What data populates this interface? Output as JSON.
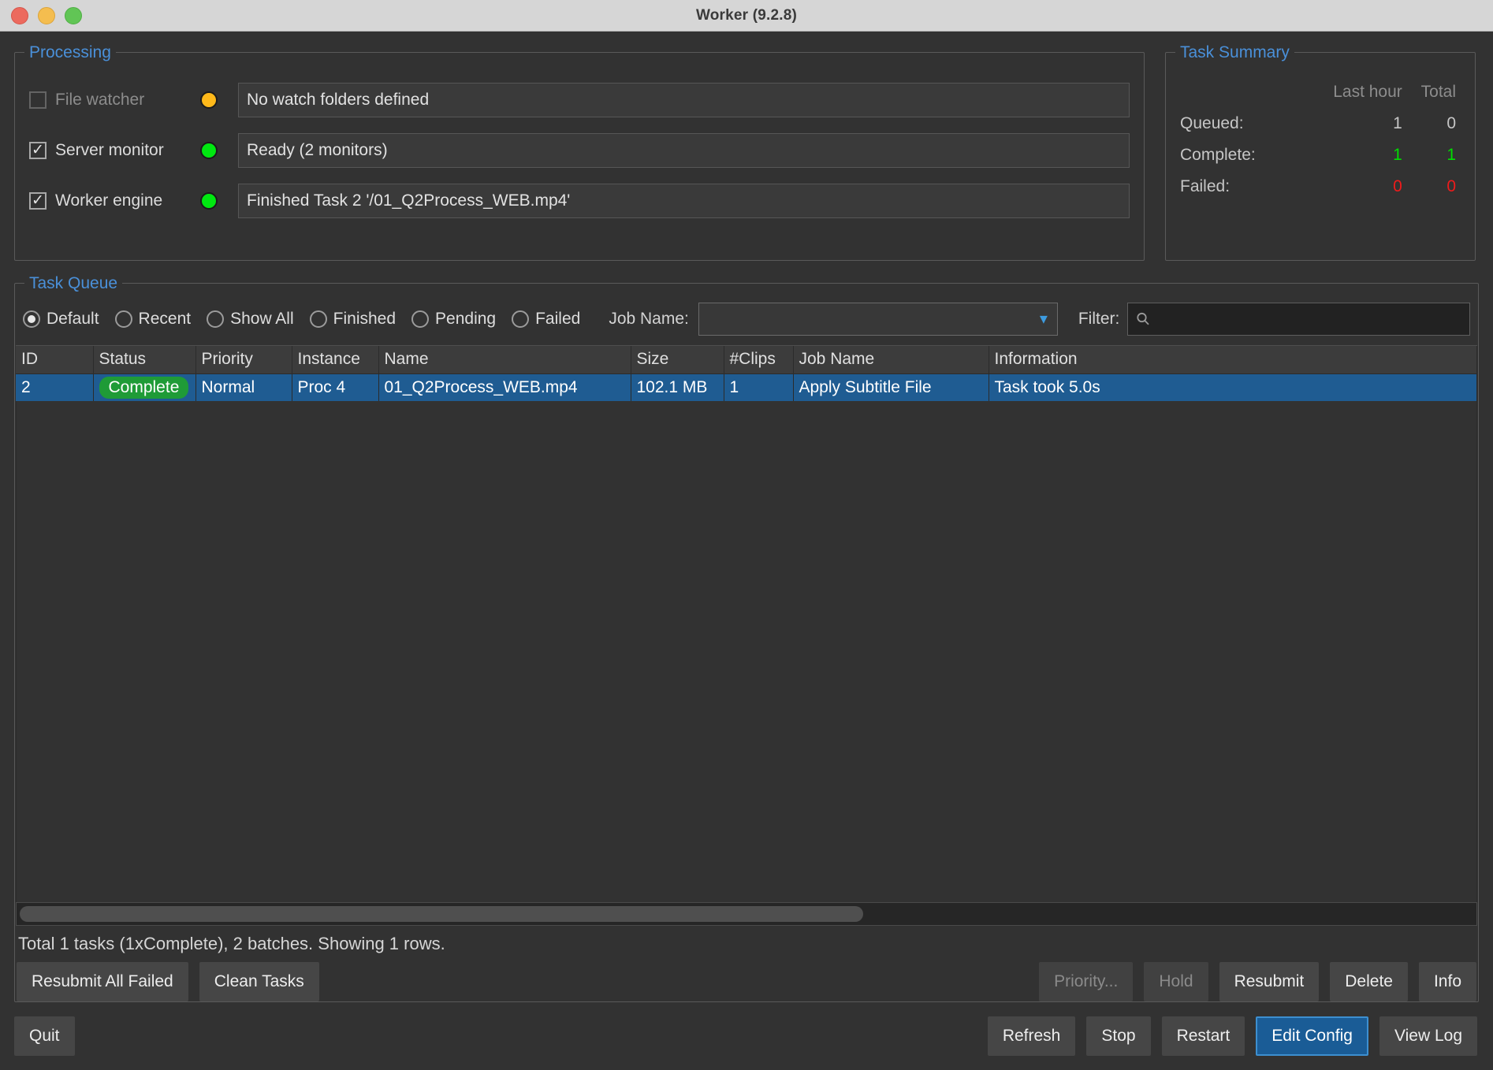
{
  "window": {
    "title": "Worker (9.2.8)",
    "traffic_lights": [
      "close",
      "minimize",
      "maximize"
    ]
  },
  "processing": {
    "legend": "Processing",
    "rows": [
      {
        "label": "File watcher",
        "checked": false,
        "enabled": false,
        "led_color": "#ffb91a",
        "status": "No watch folders defined"
      },
      {
        "label": "Server monitor",
        "checked": true,
        "enabled": true,
        "led_color": "#00e810",
        "status": "Ready (2 monitors)"
      },
      {
        "label": "Worker engine",
        "checked": true,
        "enabled": true,
        "led_color": "#00e810",
        "status": "Finished Task 2 '/01_Q2Process_WEB.mp4'"
      }
    ]
  },
  "task_summary": {
    "legend": "Task Summary",
    "columns": [
      "Last hour",
      "Total"
    ],
    "rows": [
      {
        "label": "Queued:",
        "last_hour": "1",
        "total": "0",
        "style": "neutral"
      },
      {
        "label": "Complete:",
        "last_hour": "1",
        "total": "1",
        "style": "ok"
      },
      {
        "label": "Failed:",
        "last_hour": "0",
        "total": "0",
        "style": "bad"
      }
    ]
  },
  "task_queue": {
    "legend": "Task Queue",
    "filters": [
      {
        "label": "Default",
        "selected": true
      },
      {
        "label": "Recent",
        "selected": false
      },
      {
        "label": "Show All",
        "selected": false
      },
      {
        "label": "Finished",
        "selected": false
      },
      {
        "label": "Pending",
        "selected": false
      },
      {
        "label": "Failed",
        "selected": false
      }
    ],
    "job_name_label": "Job Name:",
    "job_name_value": "",
    "filter_label": "Filter:",
    "filter_value": "",
    "filter_placeholder": "",
    "columns": [
      "ID",
      "Status",
      "Priority",
      "Instance",
      "Name",
      "Size",
      "#Clips",
      "Job Name",
      "Information"
    ],
    "rows": [
      {
        "id": "2",
        "status": "Complete",
        "priority": "Normal",
        "instance": "Proc 4",
        "name": "01_Q2Process_WEB.mp4",
        "size": "102.1 MB",
        "clips": "1",
        "job_name": "Apply Subtitle File",
        "information": "Task took 5.0s",
        "selected": true
      }
    ],
    "status_line": "Total 1 tasks (1xComplete), 2 batches. Showing 1 rows.",
    "left_actions": [
      {
        "label": "Resubmit All Failed",
        "enabled": true
      },
      {
        "label": "Clean Tasks",
        "enabled": true
      }
    ],
    "right_actions": [
      {
        "label": "Priority...",
        "enabled": false
      },
      {
        "label": "Hold",
        "enabled": false
      },
      {
        "label": "Resubmit",
        "enabled": true
      },
      {
        "label": "Delete",
        "enabled": true
      },
      {
        "label": "Info",
        "enabled": true
      }
    ]
  },
  "bottom_bar": {
    "quit": "Quit",
    "actions": [
      {
        "label": "Refresh",
        "primary": false
      },
      {
        "label": "Stop",
        "primary": false
      },
      {
        "label": "Restart",
        "primary": false
      },
      {
        "label": "Edit Config",
        "primary": true
      },
      {
        "label": "View Log",
        "primary": false
      }
    ]
  },
  "colors": {
    "accent_blue": "#4a90d9",
    "selection_blue": "#1f5c92",
    "ok_green": "#00dd00",
    "fail_red": "#ef1b1b",
    "pill_green": "#1f9b37",
    "led_amber": "#ffb91a"
  }
}
